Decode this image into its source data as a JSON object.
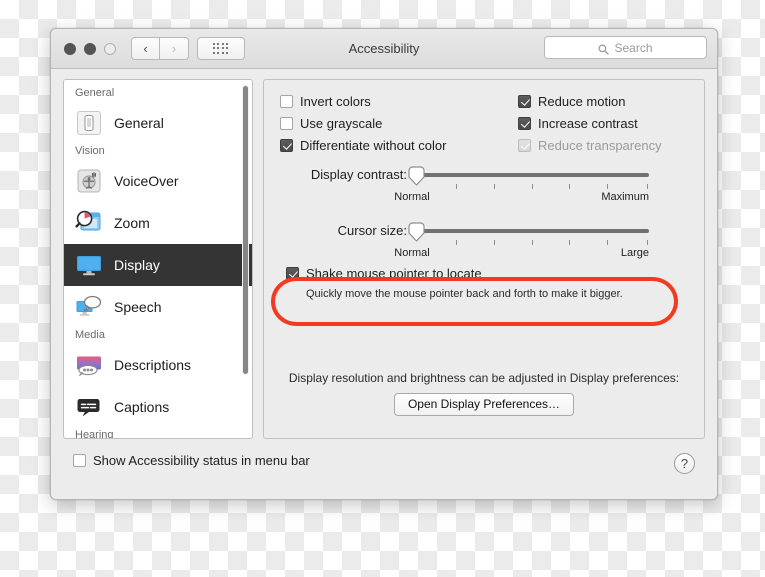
{
  "window": {
    "title": "Accessibility",
    "traffic_lights": [
      "close",
      "minimize",
      "zoom"
    ],
    "nav_back": "‹",
    "nav_forward": "›",
    "search_placeholder": "Search"
  },
  "sidebar": {
    "groups": [
      {
        "header": "General",
        "items": [
          {
            "label": "General",
            "icon": "general-icon",
            "selected": false
          }
        ]
      },
      {
        "header": "Vision",
        "items": [
          {
            "label": "VoiceOver",
            "icon": "voiceover-icon",
            "selected": false
          },
          {
            "label": "Zoom",
            "icon": "zoom-icon",
            "selected": false
          },
          {
            "label": "Display",
            "icon": "display-icon",
            "selected": true
          },
          {
            "label": "Speech",
            "icon": "speech-icon",
            "selected": false
          }
        ]
      },
      {
        "header": "Media",
        "items": [
          {
            "label": "Descriptions",
            "icon": "descriptions-icon",
            "selected": false
          },
          {
            "label": "Captions",
            "icon": "captions-icon",
            "selected": false
          }
        ]
      },
      {
        "header": "Hearing",
        "items": []
      }
    ]
  },
  "panel": {
    "checkboxes_left": [
      {
        "label": "Invert colors",
        "checked": false,
        "disabled": false
      },
      {
        "label": "Use grayscale",
        "checked": false,
        "disabled": false
      },
      {
        "label": "Differentiate without color",
        "checked": true,
        "disabled": false
      }
    ],
    "checkboxes_right": [
      {
        "label": "Reduce motion",
        "checked": true,
        "disabled": false
      },
      {
        "label": "Increase contrast",
        "checked": true,
        "disabled": false
      },
      {
        "label": "Reduce transparency",
        "checked": true,
        "disabled": true
      }
    ],
    "sliders": [
      {
        "label": "Display contrast:",
        "min_label": "Normal",
        "max_label": "Maximum",
        "value": 0,
        "ticks": 6
      },
      {
        "label": "Cursor size:",
        "min_label": "Normal",
        "max_label": "Large",
        "value": 0,
        "ticks": 6
      }
    ],
    "shake": {
      "label": "Shake mouse pointer to locate",
      "checked": true,
      "description": "Quickly move the mouse pointer back and forth to make it bigger.",
      "highlight_color": "#f23a20"
    },
    "footer_note": "Display resolution and brightness can be adjusted in Display preferences:",
    "open_display_button": "Open Display Preferences…"
  },
  "window_footer": {
    "status_checkbox": {
      "label": "Show Accessibility status in menu bar",
      "checked": false
    },
    "help_button": "?"
  }
}
